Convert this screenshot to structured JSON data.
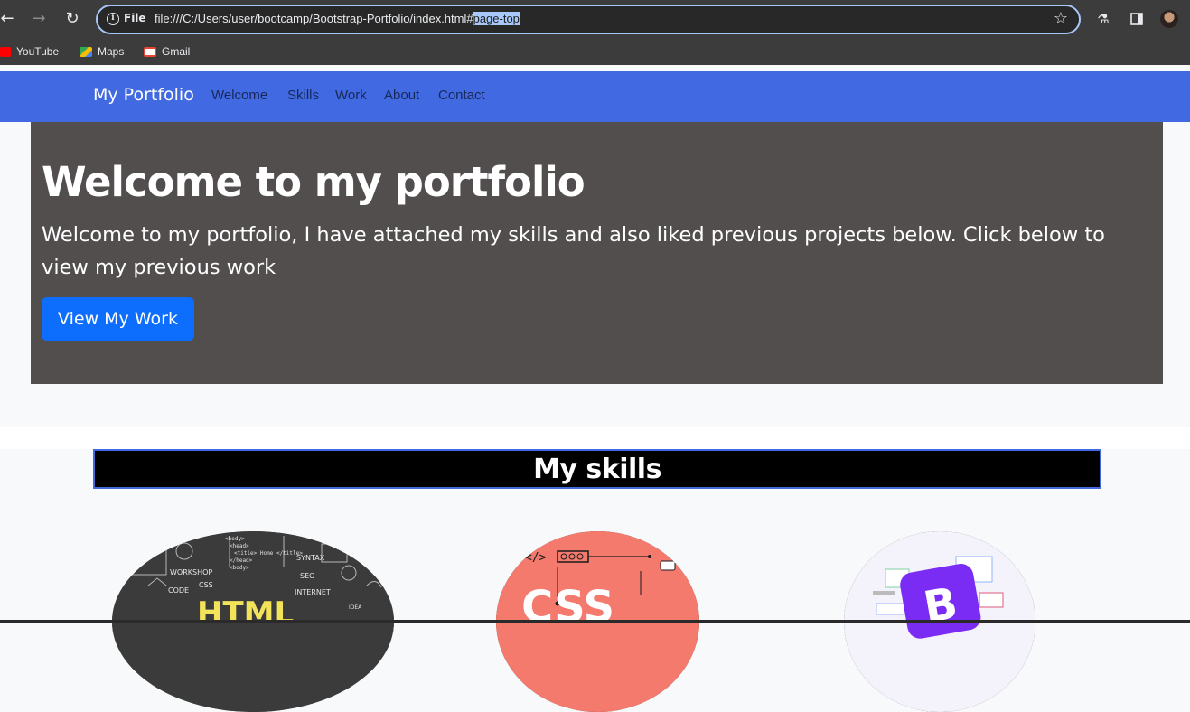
{
  "browser": {
    "omnibox": {
      "scheme_label": "File",
      "url_main": "file:///C:/Users/user/bootcamp/Bootstrap-Portfolio/index.html#",
      "url_highlight": "page-top"
    },
    "bookmarks": [
      {
        "label": "YouTube",
        "color": "#ff0000"
      },
      {
        "label": "Maps",
        "color": "#34a853"
      },
      {
        "label": "Gmail",
        "color": "#ea4335"
      }
    ]
  },
  "navbar": {
    "brand": "My Portfolio",
    "links": [
      "Welcome",
      "Skills",
      "Work",
      "About",
      "Contact"
    ],
    "color": "#4169e1"
  },
  "hero": {
    "title": "Welcome to my portfolio",
    "text": "Welcome to my portfolio, I have attached my skills and also liked previous projects below. Click below to view my previous work",
    "button_label": "View My Work"
  },
  "skills": {
    "title": "My skills",
    "images": [
      {
        "name": "HTML",
        "caption_words": [
          "WORKSHOP",
          "CODE",
          "CSS",
          "SYNTAX",
          "SEO",
          "INTERNET",
          "IDEA",
          "HTML"
        ]
      },
      {
        "name": "CSS",
        "caption_words": [
          "</>",
          "CSS"
        ]
      },
      {
        "name": "Bootstrap",
        "caption_words": [
          "B"
        ]
      }
    ]
  }
}
